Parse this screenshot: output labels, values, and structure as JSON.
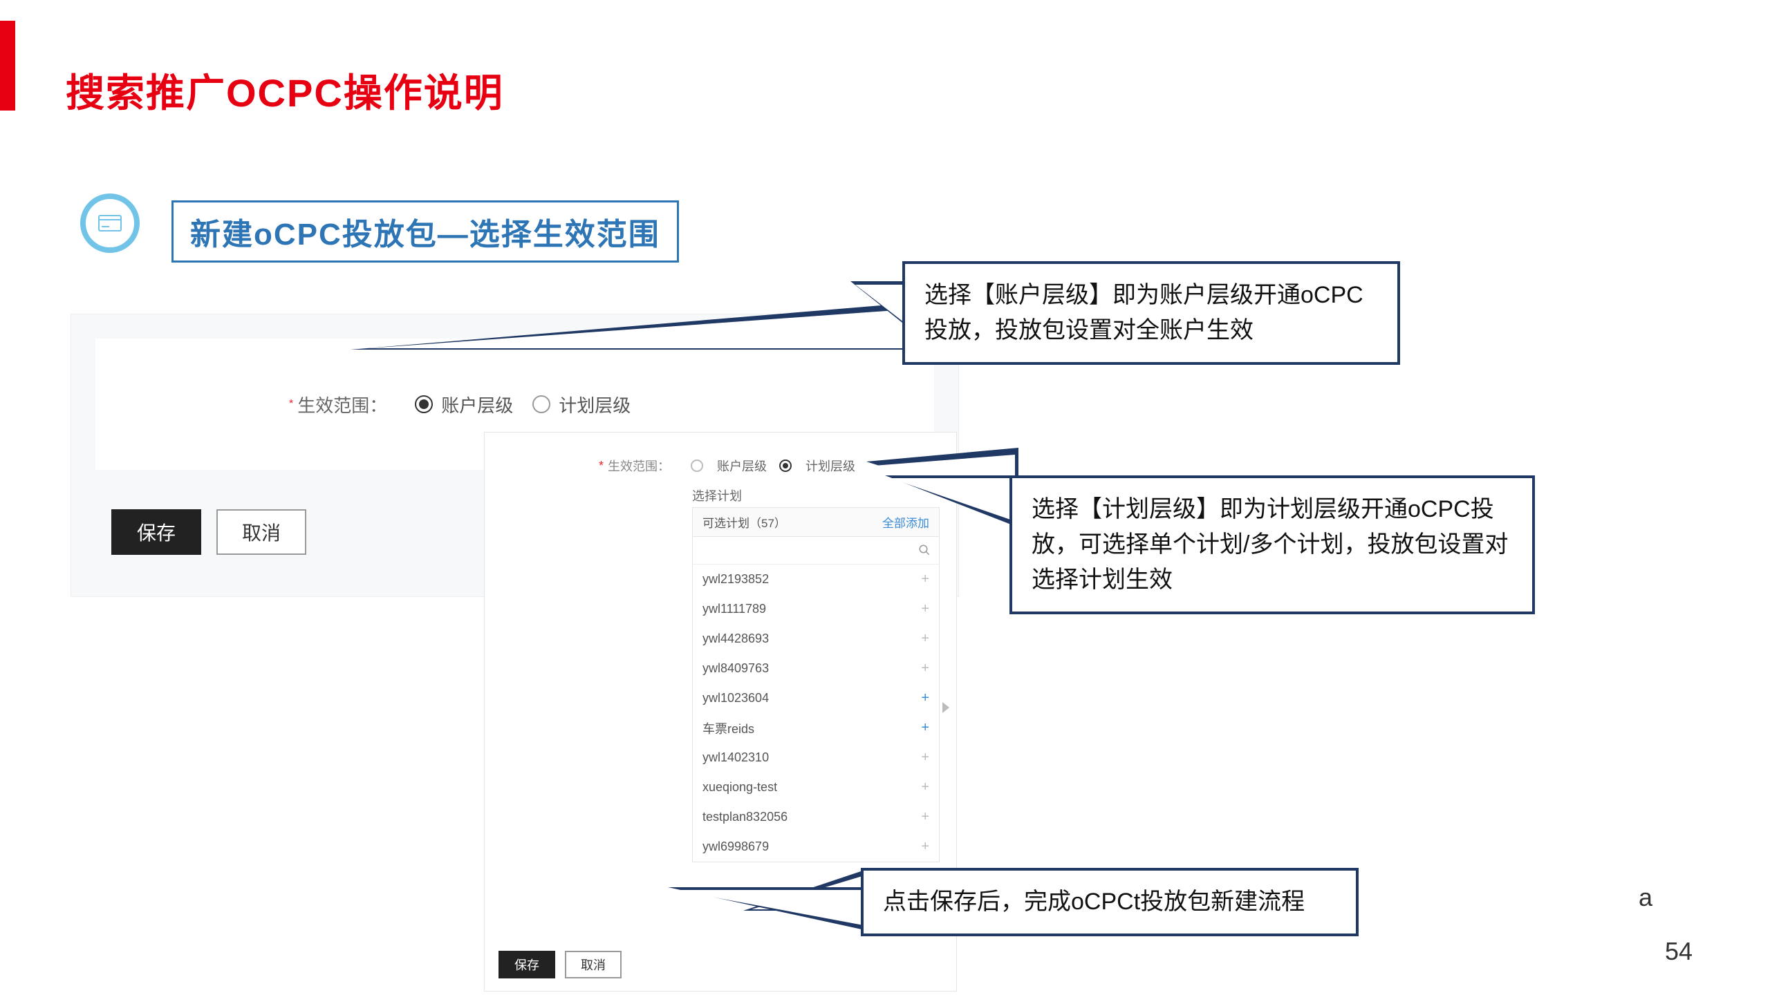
{
  "title": "搜索推广OCPC操作说明",
  "subtitle": "新建oCPC投放包—选择生效范围",
  "panel1": {
    "scope_label": "生效范围：",
    "radio_account": "账户层级",
    "radio_plan": "计划层级",
    "save": "保存",
    "cancel": "取消"
  },
  "panel2": {
    "scope_label": "生效范围：",
    "radio_account": "账户层级",
    "radio_plan": "计划层级",
    "select_plan": "选择计划",
    "optional_plans": "可选计划（57）",
    "add_all": "全部添加",
    "plans": [
      {
        "name": "ywl2193852",
        "active": false
      },
      {
        "name": "ywl1111789",
        "active": false
      },
      {
        "name": "ywl4428693",
        "active": false
      },
      {
        "name": "ywl8409763",
        "active": false
      },
      {
        "name": "ywl1023604",
        "active": true
      },
      {
        "name": "车票reids",
        "active": true
      },
      {
        "name": "ywl1402310",
        "active": false
      },
      {
        "name": "xueqiong-test",
        "active": false
      },
      {
        "name": "testplan832056",
        "active": false
      },
      {
        "name": "ywl6998679",
        "active": false
      }
    ],
    "save": "保存",
    "cancel": "取消"
  },
  "callouts": {
    "c1": "选择【账户层级】即为账户层级开通oCPC投放，投放包设置对全账户生效",
    "c2": "选择【计划层级】即为计划层级开通oCPC投放，可选择单个计划/多个计划，投放包设置对选择计划生效",
    "c3": "点击保存后，完成oCPCt投放包新建流程"
  },
  "footer_a": "a",
  "page_num": "54"
}
